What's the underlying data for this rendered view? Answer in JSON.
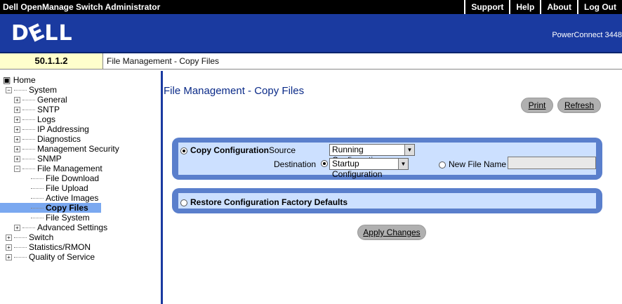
{
  "app_title": "Dell OpenManage Switch Administrator",
  "top_links": [
    "Support",
    "Help",
    "About",
    "Log Out"
  ],
  "logo": "DELL",
  "model": "PowerConnect 3448",
  "ip": "50.1.1.2",
  "breadcrumb": "File Management - Copy Files",
  "tree": [
    {
      "label": "Home"
    },
    {
      "label": "System"
    },
    {
      "label": "General"
    },
    {
      "label": "SNTP"
    },
    {
      "label": "Logs"
    },
    {
      "label": "IP Addressing"
    },
    {
      "label": "Diagnostics"
    },
    {
      "label": "Management Security"
    },
    {
      "label": "SNMP"
    },
    {
      "label": "File Management"
    },
    {
      "label": "File Download"
    },
    {
      "label": "File Upload"
    },
    {
      "label": "Active Images"
    },
    {
      "label": "Copy Files"
    },
    {
      "label": "File System"
    },
    {
      "label": "Advanced Settings"
    },
    {
      "label": "Switch"
    },
    {
      "label": "Statistics/RMON"
    },
    {
      "label": "Quality of Service"
    }
  ],
  "page_title": "File Management - Copy Files",
  "buttons": {
    "print": "Print",
    "refresh": "Refresh",
    "apply": "Apply Changes"
  },
  "copy": {
    "label": "Copy Configuration",
    "source_label": "Source",
    "source_value": "Running Configuration",
    "destination_label": "Destination",
    "destination_value": "Startup Configuration",
    "new_file_label": "New File Name",
    "new_file_value": ""
  },
  "restore_label": "Restore Configuration Factory Defaults"
}
